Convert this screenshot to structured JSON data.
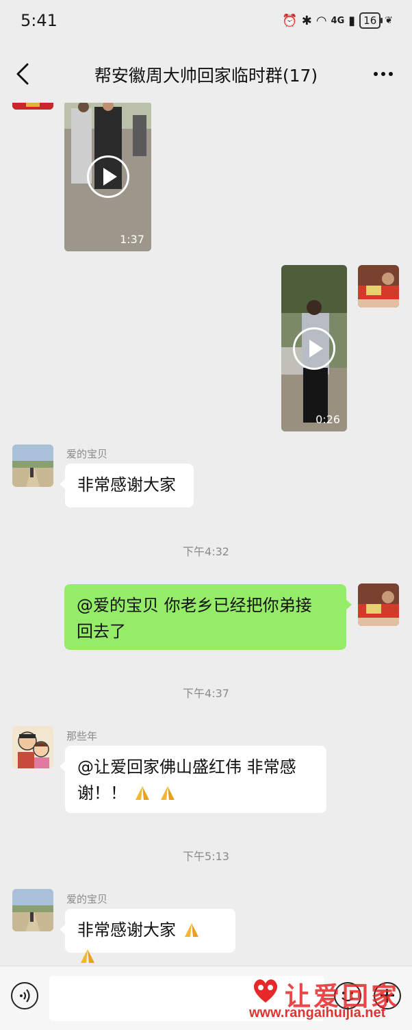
{
  "status": {
    "time": "5:41",
    "network": "4G",
    "battery": "16"
  },
  "header": {
    "title": "帮安徽周大帅回家临时群(17)"
  },
  "messages": {
    "video1": {
      "duration": "1:37"
    },
    "video2": {
      "duration": "0:26"
    },
    "msg1": {
      "sender": "爱的宝贝",
      "text": "非常感谢大家"
    },
    "time1": "下午4:32",
    "msg2": {
      "text1": "@爱的宝贝  你老乡已经把你弟接",
      "text2": "回去了"
    },
    "time2": "下午4:37",
    "msg3": {
      "sender": "那些年",
      "text1": "@让爱回家佛山盛红伟  非常感",
      "text2": "谢！！"
    },
    "time3": "下午5:13",
    "msg4": {
      "sender": "爱的宝贝",
      "text": "非常感谢大家"
    }
  },
  "input": {
    "placeholder": ""
  },
  "watermark": {
    "chars": "让爱回家",
    "url": "www.rangaihuijia.net"
  },
  "colors": {
    "my_bubble": "#95ec69",
    "their_bubble": "#ffffff",
    "background": "#ededed",
    "watermark": "#e62828"
  },
  "icons": [
    "back-icon",
    "more-icon",
    "play-icon",
    "voice-icon",
    "emoji-icon",
    "plus-icon",
    "heart-logo-icon"
  ]
}
